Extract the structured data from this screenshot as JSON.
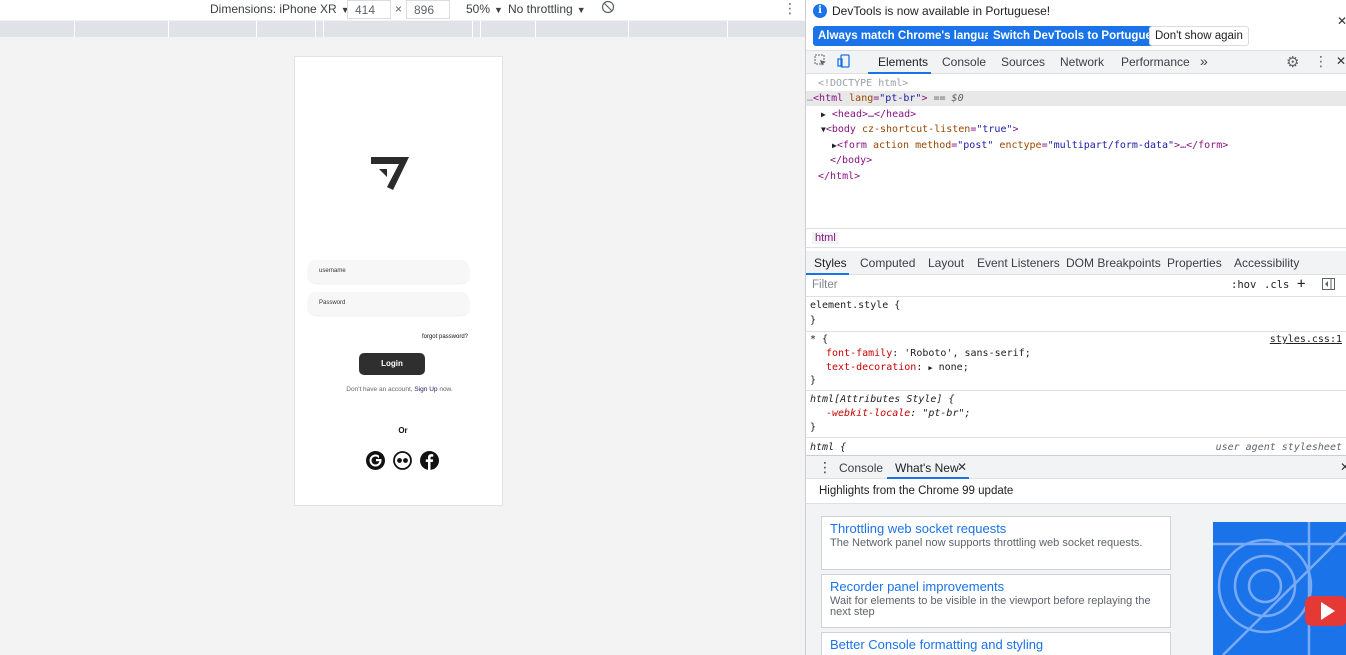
{
  "device_toolbar": {
    "dimensions_label": "Dimensions: iPhone XR",
    "width": "414",
    "times": "×",
    "height": "896",
    "zoom": "50%",
    "throttling": "No throttling"
  },
  "phone": {
    "username_placeholder": "username",
    "password_placeholder": "Password",
    "forgot_password": "forgot password?",
    "login_label": "Login",
    "signup_prefix": "Don't have an account,",
    "signup_link": "Sign Up",
    "signup_suffix": "now.",
    "or_label": "Or"
  },
  "devtools": {
    "infobar": {
      "message": "DevTools is now available in Portuguese!",
      "always_match": "Always match Chrome's language",
      "switch_lang": "Switch DevTools to Portuguese",
      "dont_show": "Don't show again"
    },
    "main_tabs": [
      "Elements",
      "Console",
      "Sources",
      "Network",
      "Performance"
    ],
    "dom": {
      "doctype": "<!DOCTYPE html>",
      "html_lang": "\"pt-br\"",
      "eq_sel": "== $0",
      "head": "<head>…</head>",
      "body_attr": "cz-shortcut-listen",
      "body_val": "\"true\"",
      "form_action": "action",
      "form_method": "method",
      "form_method_val": "\"post\"",
      "form_enctype": "enctype",
      "form_enctype_val": "\"multipart/form-data\"",
      "form_close": "…</form>",
      "body_close": "</body>",
      "html_close": "</html>"
    },
    "breadcrumb": "html",
    "sub_tabs": [
      "Styles",
      "Computed",
      "Layout",
      "Event Listeners",
      "DOM Breakpoints",
      "Properties",
      "Accessibility"
    ],
    "filter_placeholder": "Filter",
    "hov": ":hov",
    "cls": ".cls",
    "styles": {
      "element_style": "element.style {",
      "close_brace": "}",
      "universal_selector": "* {",
      "source": "styles.css:1",
      "font_family_prop": "font-family",
      "font_family_val": "'Roboto', sans-serif;",
      "text_decoration_prop": "text-decoration",
      "text_decoration_val": "none;",
      "attr_style_selector": "html[Attributes Style] {",
      "locale_prop": "-webkit-locale",
      "locale_val": "\"pt-br\";",
      "html_selector": "html {",
      "ua_source": "user agent stylesheet"
    },
    "drawer_tabs": [
      "Console",
      "What's New"
    ],
    "whats_new": {
      "highlights": "Highlights from the Chrome 99 update",
      "cards": [
        {
          "title": "Throttling web socket requests",
          "desc": "The Network panel now supports throttling web socket requests."
        },
        {
          "title": "Recorder panel improvements",
          "desc": "Wait for elements to be visible in the viewport before replaying the next step"
        },
        {
          "title": "Better Console formatting and styling",
          "desc": ""
        }
      ]
    }
  }
}
